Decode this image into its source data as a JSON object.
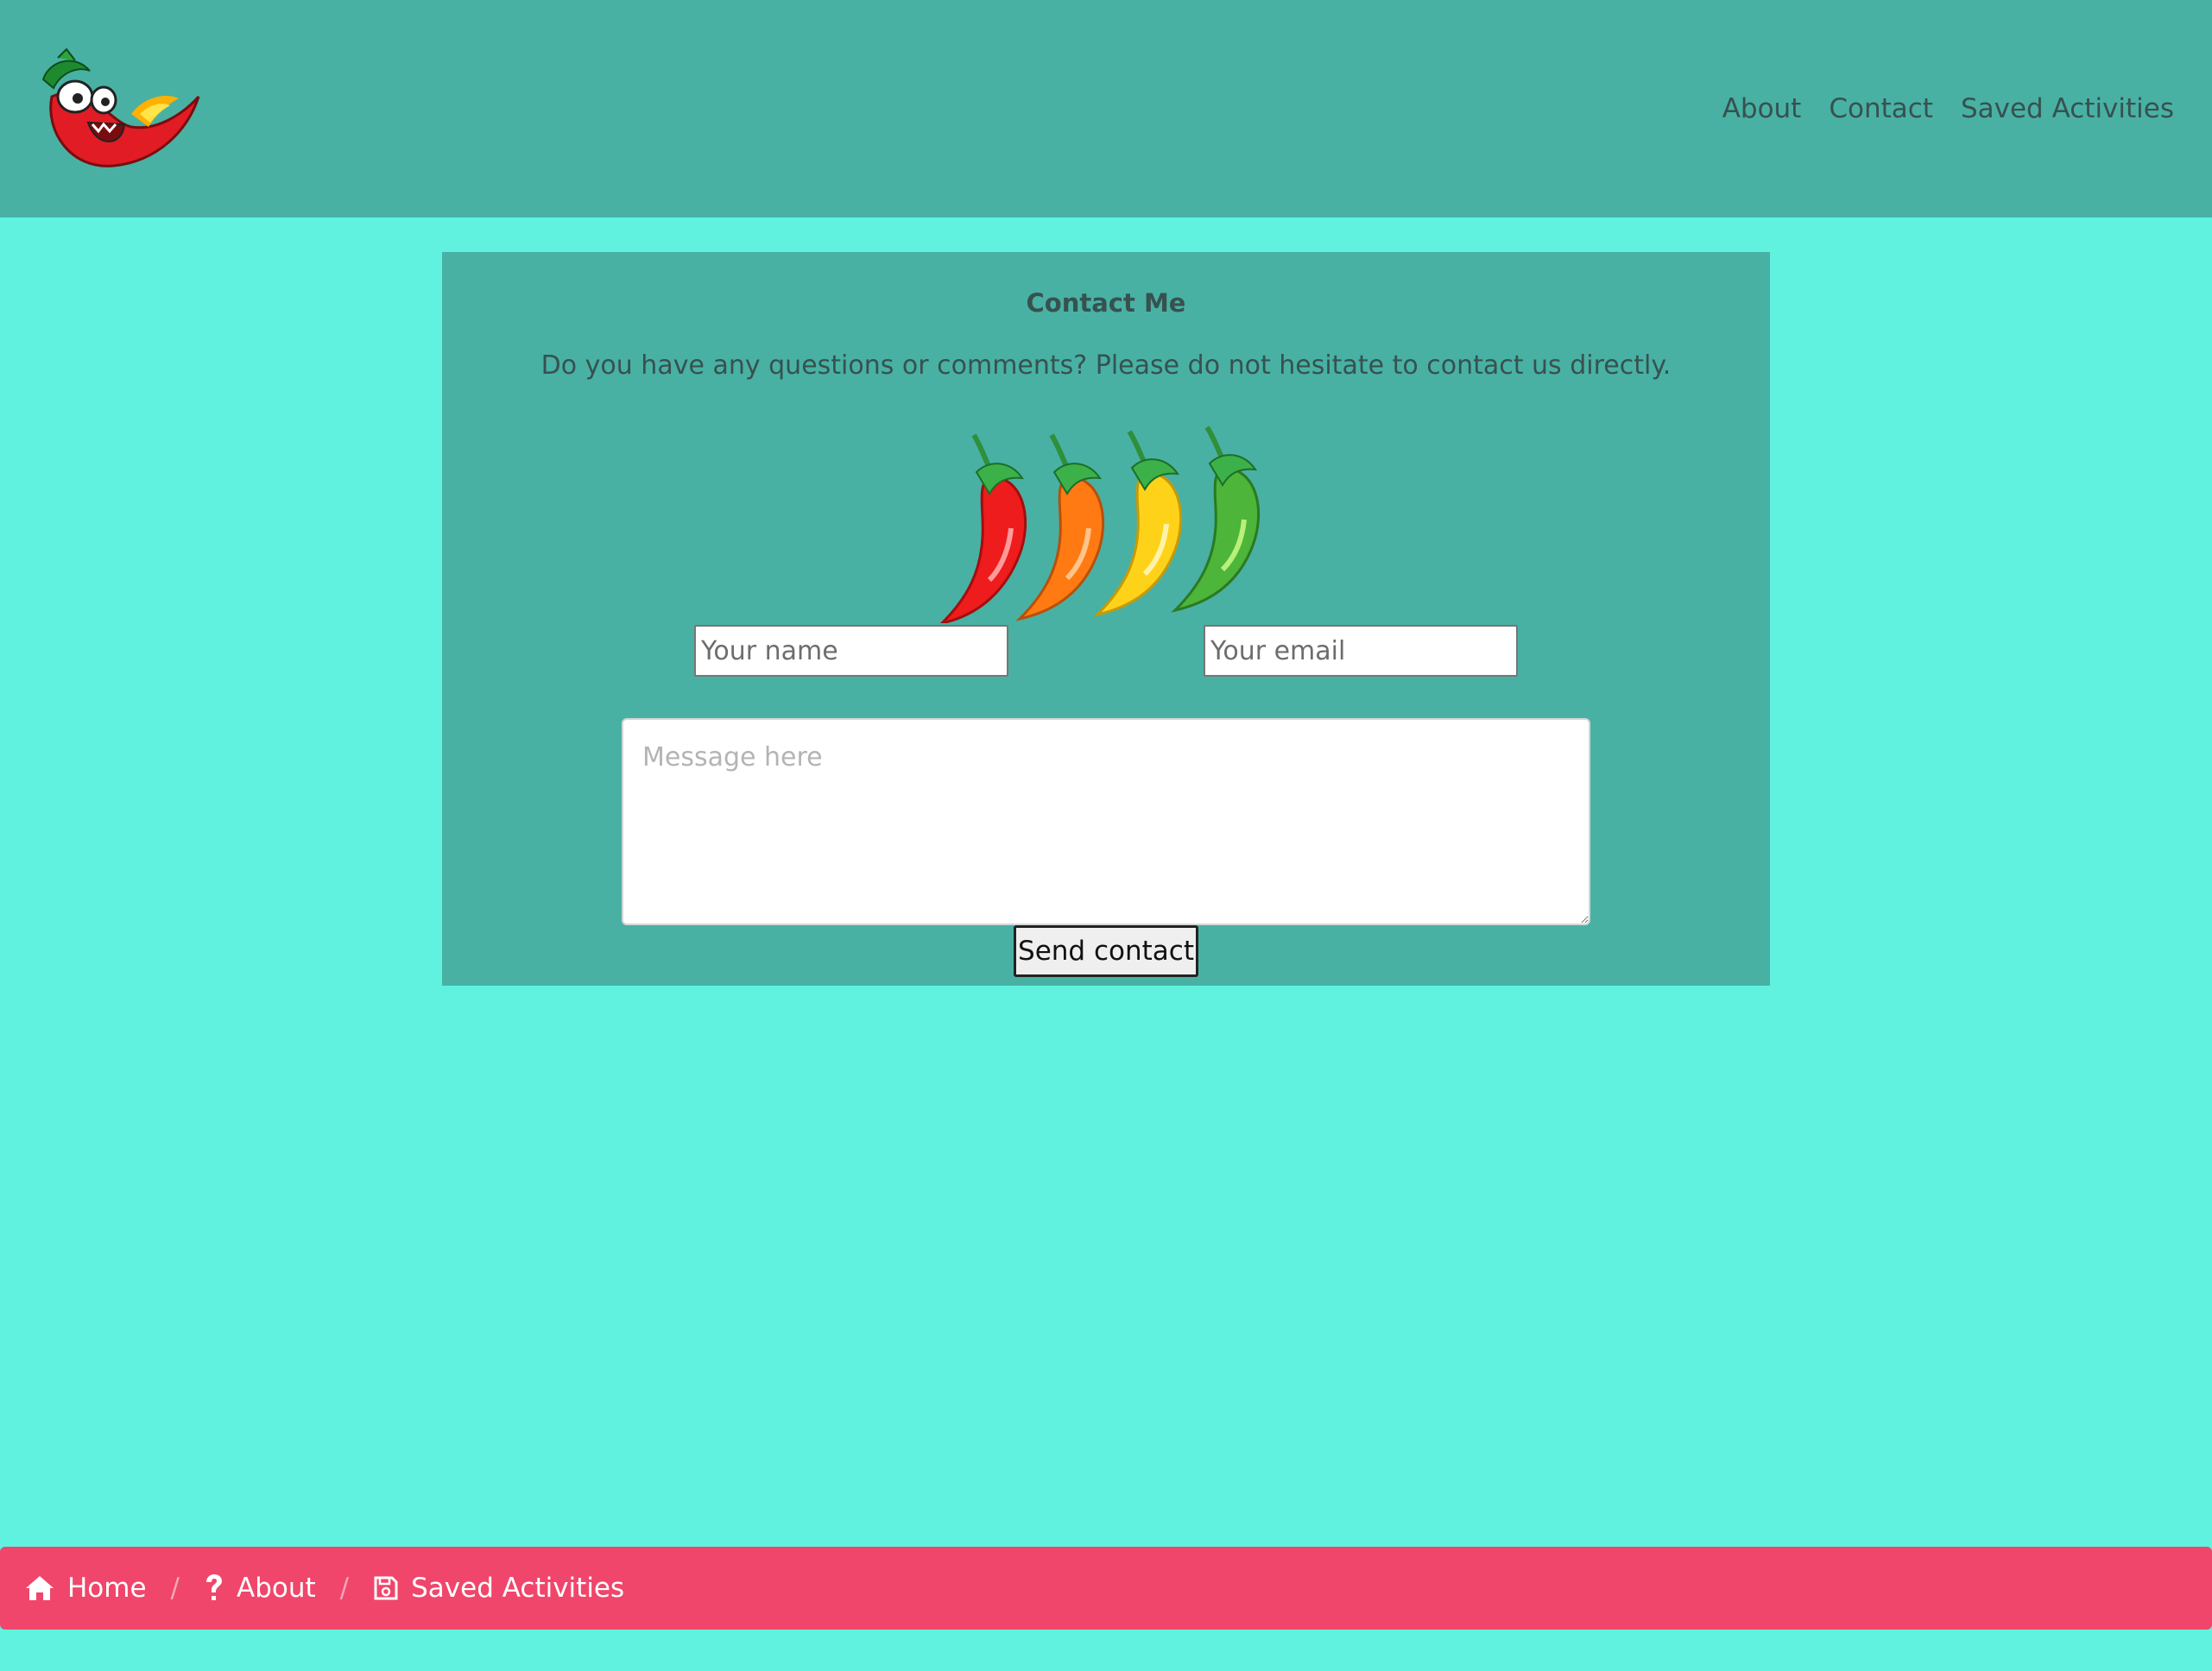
{
  "header": {
    "logo_icon": "chili-mascot-icon",
    "nav": [
      {
        "label": "About"
      },
      {
        "label": "Contact"
      },
      {
        "label": "Saved Activities"
      }
    ]
  },
  "contact": {
    "title": "Contact Me",
    "subtitle": "Do you have any questions or comments? Please do not hesitate to contact us directly.",
    "image_icon": "four-chili-peppers-icon",
    "name_placeholder": "Your name",
    "email_placeholder": "Your email",
    "message_placeholder": "Message here",
    "send_label": "Send contact"
  },
  "footer": {
    "separator": "/",
    "crumbs": [
      {
        "label": "Home",
        "icon": "home-icon"
      },
      {
        "label": "About",
        "icon": "question-icon"
      },
      {
        "label": "Saved Activities",
        "icon": "save-icon"
      }
    ]
  },
  "colors": {
    "page_bg": "#60f2de",
    "header_bg": "#48b1a4",
    "footer_bg": "#f0466b",
    "text": "#37514f"
  }
}
